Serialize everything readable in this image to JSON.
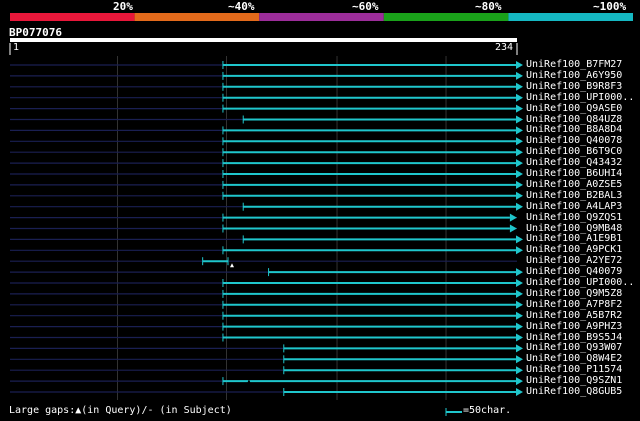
{
  "query": {
    "name": "BP077076",
    "length_start": "1",
    "length_end": "234"
  },
  "scale": {
    "labels": [
      "20%",
      "~40%",
      "~60%",
      "~80%",
      "~100%"
    ],
    "colors": [
      "#e8173a",
      "#e36a1b",
      "#9c2d9a",
      "#1aa21a",
      "#15b8c2"
    ]
  },
  "footer": {
    "gaps_text": "Large gaps:▲(in Query)/- (in Subject)",
    "legend_text": "=50char."
  },
  "hits": [
    {
      "label": "UniRef100_B7FM27",
      "start": 0.42,
      "end": 0.998,
      "gap": null,
      "arrow": true
    },
    {
      "label": "UniRef100_A6Y950",
      "start": 0.42,
      "end": 0.998,
      "gap": null,
      "arrow": true
    },
    {
      "label": "UniRef100_B9R8F3",
      "start": 0.42,
      "end": 0.998,
      "gap": null,
      "arrow": true
    },
    {
      "label": "UniRef100_UPI000..",
      "start": 0.42,
      "end": 0.998,
      "gap": null,
      "arrow": true
    },
    {
      "label": "UniRef100_Q9ASE0",
      "start": 0.42,
      "end": 0.998,
      "gap": null,
      "arrow": true
    },
    {
      "label": "UniRef100_Q84UZ8",
      "start": 0.46,
      "end": 0.998,
      "gap": null,
      "arrow": true
    },
    {
      "label": "UniRef100_B8A8D4",
      "start": 0.42,
      "end": 0.998,
      "gap": null,
      "arrow": true
    },
    {
      "label": "UniRef100_Q40078",
      "start": 0.42,
      "end": 0.998,
      "gap": null,
      "arrow": true
    },
    {
      "label": "UniRef100_B6T9C0",
      "start": 0.42,
      "end": 0.998,
      "gap": null,
      "arrow": true
    },
    {
      "label": "UniRef100_Q43432",
      "start": 0.42,
      "end": 0.998,
      "gap": null,
      "arrow": true
    },
    {
      "label": "UniRef100_B6UHI4",
      "start": 0.42,
      "end": 0.998,
      "gap": null,
      "arrow": true
    },
    {
      "label": "UniRef100_A0ZSE5",
      "start": 0.42,
      "end": 0.998,
      "gap": null,
      "arrow": true
    },
    {
      "label": "UniRef100_B2BAL3",
      "start": 0.42,
      "end": 0.998,
      "gap": null,
      "arrow": true
    },
    {
      "label": "UniRef100_A4LAP3",
      "start": 0.46,
      "end": 0.998,
      "gap": null,
      "arrow": true
    },
    {
      "label": "UniRef100_Q9ZQS1",
      "start": 0.42,
      "end": 0.986,
      "gap": null,
      "arrow": true
    },
    {
      "label": "UniRef100_Q9MB48",
      "start": 0.42,
      "end": 0.986,
      "gap": null,
      "arrow": true
    },
    {
      "label": "UniRef100_A1E9B1",
      "start": 0.46,
      "end": 0.998,
      "gap": null,
      "arrow": true
    },
    {
      "label": "UniRef100_A9PCK1",
      "start": 0.42,
      "end": 0.998,
      "gap": null,
      "arrow": true
    },
    {
      "label": "UniRef100_A2YE72",
      "start": 0.38,
      "end": 0.43,
      "gap": "query",
      "arrow": false
    },
    {
      "label": "UniRef100_Q40079",
      "start": 0.51,
      "end": 0.998,
      "gap": null,
      "arrow": true
    },
    {
      "label": "UniRef100_UPI000..",
      "start": 0.42,
      "end": 0.998,
      "gap": null,
      "arrow": true
    },
    {
      "label": "UniRef100_Q9M5Z8",
      "start": 0.42,
      "end": 0.998,
      "gap": null,
      "arrow": true
    },
    {
      "label": "UniRef100_A7P8F2",
      "start": 0.42,
      "end": 0.998,
      "gap": null,
      "arrow": true
    },
    {
      "label": "UniRef100_A5B7R2",
      "start": 0.42,
      "end": 0.998,
      "gap": null,
      "arrow": true
    },
    {
      "label": "UniRef100_A9PHZ3",
      "start": 0.42,
      "end": 0.998,
      "gap": null,
      "arrow": true
    },
    {
      "label": "UniRef100_B9S5J4",
      "start": 0.42,
      "end": 0.998,
      "gap": null,
      "arrow": true
    },
    {
      "label": "UniRef100_Q93W07",
      "start": 0.54,
      "end": 0.998,
      "gap": null,
      "arrow": true
    },
    {
      "label": "UniRef100_Q8W4E2",
      "start": 0.54,
      "end": 0.998,
      "gap": null,
      "arrow": true
    },
    {
      "label": "UniRef100_P11574",
      "start": 0.54,
      "end": 0.998,
      "gap": null,
      "arrow": true
    },
    {
      "label": "UniRef100_Q9SZN1",
      "start": 0.42,
      "end": 0.998,
      "gap": "subject",
      "arrow": true
    },
    {
      "label": "UniRef100_Q8GUB5",
      "start": 0.54,
      "end": 0.998,
      "gap": null,
      "arrow": true
    }
  ]
}
